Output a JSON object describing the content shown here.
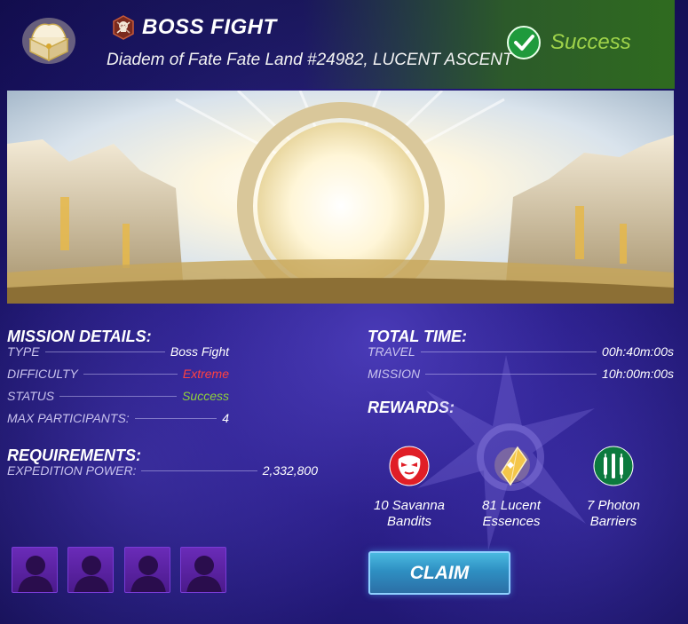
{
  "header": {
    "chest_icon": "treasure-chest-icon",
    "badge_icon": "skull-crossbones-icon",
    "title": "BOSS FIGHT",
    "subtitle": "Diadem of Fate Fate Land #24982, LUCENT ASCENT",
    "status_icon": "check-circle-icon",
    "status_label": "Success"
  },
  "mission_details": {
    "title": "MISSION DETAILS:",
    "rows": [
      {
        "label": "TYPE",
        "value": "Boss Fight"
      },
      {
        "label": "DIFFICULTY",
        "value": "Extreme"
      },
      {
        "label": "STATUS",
        "value": "Success"
      },
      {
        "label": "MAX PARTICIPANTS:",
        "value": "4"
      }
    ]
  },
  "requirements": {
    "title": "REQUIREMENTS:",
    "rows": [
      {
        "label": "EXPEDITION POWER:",
        "value": "2,332,800"
      }
    ]
  },
  "total_time": {
    "title": "TOTAL TIME:",
    "rows": [
      {
        "label": "TRAVEL",
        "value": "00h:40m:00s"
      },
      {
        "label": "MISSION",
        "value": "10h:00m:00s"
      }
    ]
  },
  "rewards": {
    "title": "REWARDS:",
    "items": [
      {
        "icon": "savanna-bandit-mask-icon",
        "line1": "10 Savanna",
        "line2": "Bandits"
      },
      {
        "icon": "lucent-essence-crystal-icon",
        "line1": "81 Lucent",
        "line2": "Essences"
      },
      {
        "icon": "photon-barrier-bars-icon",
        "line1": "7 Photon",
        "line2": "Barriers"
      }
    ]
  },
  "claim_label": "CLAIM",
  "participants": {
    "slots": 4,
    "slot_icon": "silhouette-avatar-icon"
  },
  "colors": {
    "success": "#8fd23a",
    "extreme": "#ff4141",
    "claim": "#3aa3d6",
    "slot": "#5a24a3"
  }
}
